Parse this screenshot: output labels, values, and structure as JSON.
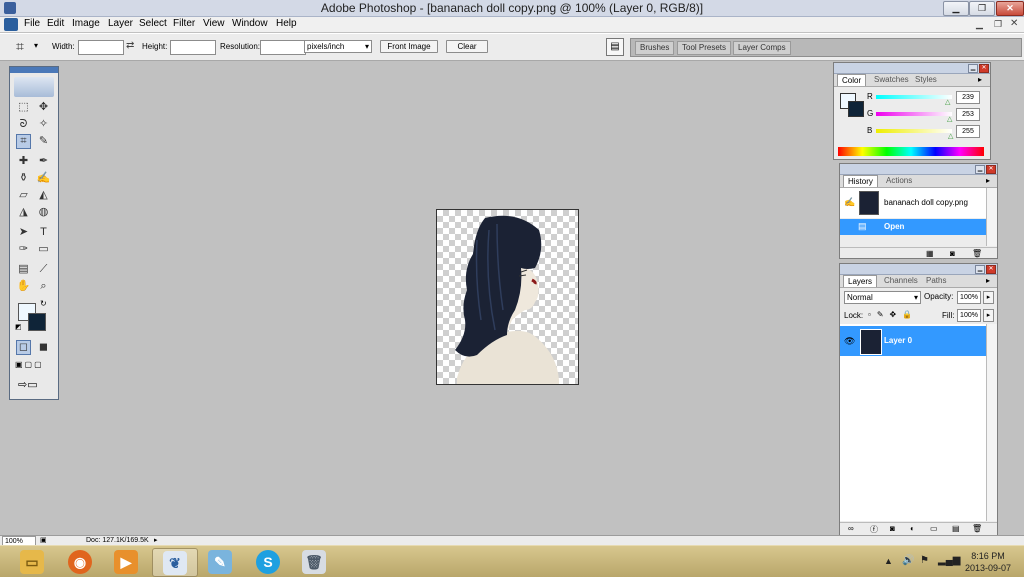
{
  "window": {
    "title": "Adobe Photoshop - [bananach doll copy.png @ 100% (Layer 0, RGB/8)]",
    "minimize": "▁",
    "restore": "❐",
    "close": "✕"
  },
  "menu": [
    "File",
    "Edit",
    "Image",
    "Layer",
    "Select",
    "Filter",
    "View",
    "Window",
    "Help"
  ],
  "options": {
    "width_label": "Width:",
    "width_value": "",
    "height_label": "Height:",
    "height_value": "",
    "resolution_label": "Resolution:",
    "resolution_value": "",
    "units": "pixels/inch",
    "front_image": "Front Image",
    "clear": "Clear"
  },
  "palette_well": [
    "Brushes",
    "Tool Presets",
    "Layer Comps"
  ],
  "color_panel": {
    "tabs": [
      "Color",
      "Swatches",
      "Styles"
    ],
    "r_label": "R",
    "r_value": "239",
    "g_label": "G",
    "g_value": "253",
    "b_label": "B",
    "b_value": "255",
    "foreground": "#eff8ff",
    "background": "#0f2438"
  },
  "history_panel": {
    "tabs": [
      "History",
      "Actions"
    ],
    "snapshot": "bananach doll copy.png",
    "state": "Open"
  },
  "layers_panel": {
    "tabs": [
      "Layers",
      "Channels",
      "Paths"
    ],
    "blend_mode": "Normal",
    "opacity_label": "Opacity:",
    "opacity": "100%",
    "lock_label": "Lock:",
    "fill_label": "Fill:",
    "fill": "100%",
    "layer_name": "Layer 0"
  },
  "status": {
    "zoom": "100%",
    "doc": "Doc: 127.1K/169.5K"
  },
  "taskbar": {
    "time": "8:16 PM",
    "date": "2013-09-07",
    "apps": [
      "file-explorer-icon",
      "firefox-icon",
      "media-player-icon",
      "photoshop-feather-icon",
      "paint-icon",
      "skype-icon",
      "recycle-bin-icon"
    ]
  },
  "colors": {
    "selection": "#3399ff",
    "workspace": "#c1c1c1"
  }
}
